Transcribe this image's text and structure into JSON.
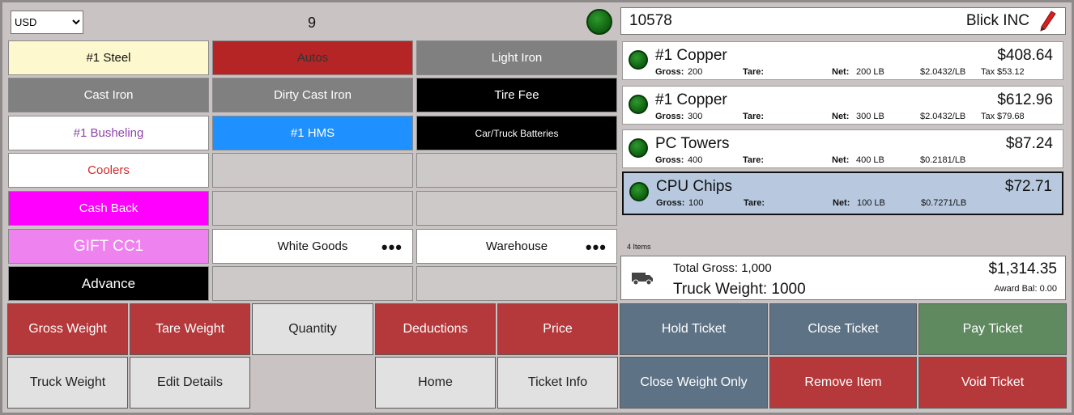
{
  "header": {
    "currency_options": [
      "USD"
    ],
    "currency": "USD",
    "count": "9"
  },
  "products": [
    {
      "label": "#1 Steel",
      "bg": "#fdf8cd",
      "fg": "#111111"
    },
    {
      "label": "Autos",
      "bg": "#b52525",
      "fg": "#333333"
    },
    {
      "label": "Light Iron",
      "bg": "#808080",
      "fg": "#ffffff"
    },
    {
      "label": "Cast Iron",
      "bg": "#808080",
      "fg": "#ffffff"
    },
    {
      "label": "Dirty Cast Iron",
      "bg": "#808080",
      "fg": "#ffffff"
    },
    {
      "label": "Tire Fee",
      "bg": "#000000",
      "fg": "#ffffff"
    },
    {
      "label": "#1 Busheling",
      "bg": "#ffffff",
      "fg": "#8e44ad"
    },
    {
      "label": "#1 HMS",
      "bg": "#1e90ff",
      "fg": "#ffffff"
    },
    {
      "label": "Car/Truck Batteries",
      "bg": "#000000",
      "fg": "#ffffff"
    },
    {
      "label": "Coolers",
      "bg": "#ffffff",
      "fg": "#d42a2a"
    },
    {
      "label": "",
      "bg": "#cdc9c9",
      "fg": "#111111"
    },
    {
      "label": "",
      "bg": "#cdc9c9",
      "fg": "#111111"
    },
    {
      "label": "Cash Back",
      "bg": "#ff00ff",
      "fg": "#ffffff"
    },
    {
      "label": "",
      "bg": "#cdc9c9",
      "fg": "#111111"
    },
    {
      "label": "",
      "bg": "#cdc9c9",
      "fg": "#111111"
    },
    {
      "label": "GIFT CC1",
      "bg": "#ee82ee",
      "fg": "#ffffff"
    },
    {
      "label": "White Goods",
      "bg": "#ffffff",
      "fg": "#111111",
      "more": "•••"
    },
    {
      "label": "Warehouse",
      "bg": "#ffffff",
      "fg": "#111111",
      "more": "•••"
    },
    {
      "label": "Advance",
      "bg": "#000000",
      "fg": "#ffffff"
    },
    {
      "label": "",
      "bg": "#cdc9c9",
      "fg": "#111111"
    },
    {
      "label": "",
      "bg": "#cdc9c9",
      "fg": "#111111"
    }
  ],
  "customer": {
    "number": "10578",
    "name": "Blick INC",
    "edit_icon": "pencil-icon"
  },
  "ticket": {
    "labels": {
      "gross": "Gross:",
      "tare": "Tare:",
      "net": "Net:",
      "tax": "Tax"
    },
    "items": [
      {
        "name": "#1 Copper",
        "price": "$408.64",
        "gross": "200",
        "tare": "",
        "net": "200 LB",
        "rate": "$2.0432/LB",
        "tax": "$53.12",
        "selected": false
      },
      {
        "name": "#1 Copper",
        "price": "$612.96",
        "gross": "300",
        "tare": "",
        "net": "300 LB",
        "rate": "$2.0432/LB",
        "tax": "$79.68",
        "selected": false
      },
      {
        "name": "PC Towers",
        "price": "$87.24",
        "gross": "400",
        "tare": "",
        "net": "400 LB",
        "rate": "$0.2181/LB",
        "tax": "",
        "selected": false
      },
      {
        "name": "CPU Chips",
        "price": "$72.71",
        "gross": "100",
        "tare": "",
        "net": "100 LB",
        "rate": "$0.7271/LB",
        "tax": "",
        "selected": true
      }
    ],
    "items_count": "4  Items"
  },
  "totals": {
    "total_gross": "Total Gross: 1,000",
    "truck_weight": "Truck Weight: 1000",
    "amount": "$1,314.35",
    "award_bal": "Award Bal:  0.00"
  },
  "actions": {
    "gross_weight": "Gross Weight",
    "tare_weight": "Tare Weight",
    "quantity": "Quantity",
    "deductions": "Deductions",
    "price": "Price",
    "hold_ticket": "Hold Ticket",
    "close_ticket": "Close Ticket",
    "pay_ticket": "Pay Ticket",
    "truck_weight": "Truck Weight",
    "edit_details": "Edit Details",
    "home": "Home",
    "ticket_info": "Ticket Info",
    "close_weight_only": "Close Weight Only",
    "remove_item": "Remove Item",
    "void_ticket": "Void Ticket"
  },
  "colors": {
    "red": "#b5383a",
    "slate": "#5e7286",
    "green": "#5f8a5f",
    "light": "#e2e1e1",
    "status_green": "#1e7a1e"
  }
}
